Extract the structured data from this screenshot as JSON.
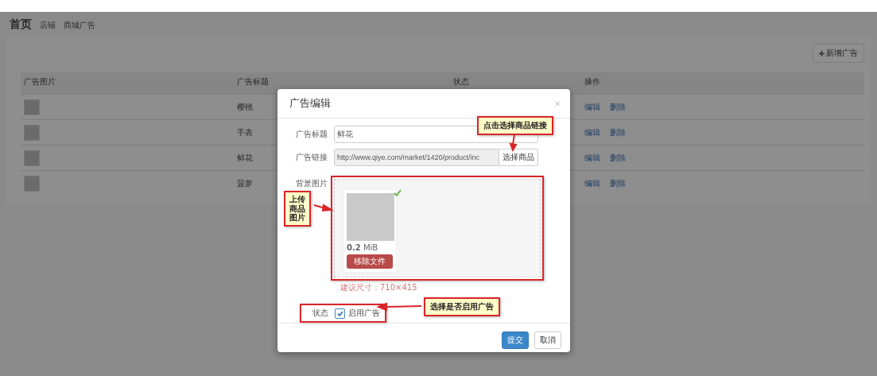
{
  "breadcrumb": [
    {
      "label": "首页",
      "kind": "home"
    },
    {
      "label": "店铺",
      "kind": "crumb"
    },
    {
      "label": "商城广告",
      "kind": "crumb"
    }
  ],
  "add_button": {
    "label": "新增广告"
  },
  "table": {
    "columns": [
      "广告图片",
      "广告标题",
      "状态",
      "操作"
    ],
    "rows": [
      {
        "title": "樱桃",
        "actions": [
          "编辑",
          "删除"
        ]
      },
      {
        "title": "手表",
        "actions": [
          "编辑",
          "删除"
        ]
      },
      {
        "title": "鲜花",
        "actions": [
          "编辑",
          "删除"
        ]
      },
      {
        "title": "菠萝",
        "actions": [
          "编辑",
          "删除"
        ]
      }
    ]
  },
  "modal": {
    "title": "广告编辑",
    "close": "×",
    "fields": [
      {
        "label": "广告标题",
        "value": "鲜花",
        "kind": "text"
      },
      {
        "label": "广告链接",
        "value": "http://www.qiye.com/market/1420/product/inc",
        "kind": "link",
        "button": "选择商品"
      }
    ],
    "image_label": "背景图片",
    "file": {
      "size": "0.2",
      "unit": "MiB",
      "remove": "移除文件",
      "uploaded": true
    },
    "hint": "建议尺寸：710×415",
    "status": {
      "label": "状态",
      "checkbox_label": "启用广告",
      "checked": true
    },
    "buttons": [
      {
        "label": "提交",
        "kind": "primary"
      },
      {
        "label": "取消",
        "kind": "default"
      }
    ]
  },
  "annotations": [
    {
      "text": "点击选择商品链接",
      "kind": "link"
    },
    {
      "text": "上传商品图片",
      "kind": "upload"
    },
    {
      "text": "选择是否启用广告",
      "kind": "status"
    }
  ]
}
